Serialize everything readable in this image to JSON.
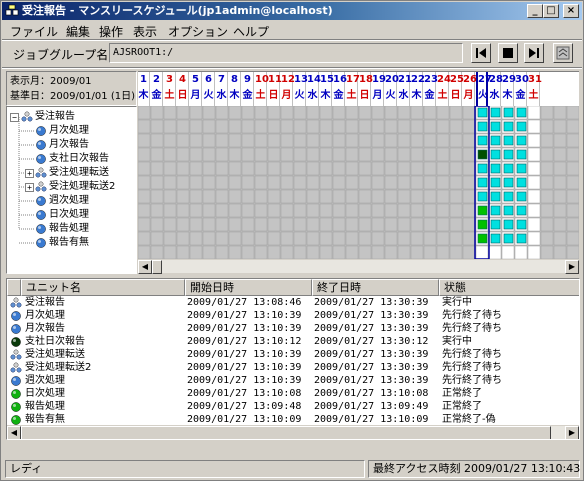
{
  "window": {
    "title": "受注報告 - マンスリースケジュール(jp1admin@localhost)",
    "controls": {
      "minimize": "_",
      "maximize": "□",
      "close": "×"
    }
  },
  "menu": [
    "ファイル",
    "編集",
    "操作",
    "表示",
    "オプション",
    "ヘルプ"
  ],
  "toolbar": {
    "jobgroup_label": "ジョブグループ名:",
    "jobgroup_value": "AJSROOT1:/"
  },
  "info": {
    "display_month": "表示月：2009/01",
    "base_day": "基準日：2009/01/01 (1日)"
  },
  "calendar": {
    "days": [
      {
        "d": "1",
        "w": "木",
        "c": "blue"
      },
      {
        "d": "2",
        "w": "金",
        "c": "blue"
      },
      {
        "d": "3",
        "w": "土",
        "c": "red"
      },
      {
        "d": "4",
        "w": "日",
        "c": "red"
      },
      {
        "d": "5",
        "w": "月",
        "c": "blue"
      },
      {
        "d": "6",
        "w": "火",
        "c": "blue"
      },
      {
        "d": "7",
        "w": "水",
        "c": "blue"
      },
      {
        "d": "8",
        "w": "木",
        "c": "blue"
      },
      {
        "d": "9",
        "w": "金",
        "c": "blue"
      },
      {
        "d": "10",
        "w": "土",
        "c": "red"
      },
      {
        "d": "11",
        "w": "日",
        "c": "red"
      },
      {
        "d": "12",
        "w": "月",
        "c": "red"
      },
      {
        "d": "13",
        "w": "火",
        "c": "blue"
      },
      {
        "d": "14",
        "w": "水",
        "c": "blue"
      },
      {
        "d": "15",
        "w": "木",
        "c": "blue"
      },
      {
        "d": "16",
        "w": "金",
        "c": "blue"
      },
      {
        "d": "17",
        "w": "土",
        "c": "red"
      },
      {
        "d": "18",
        "w": "日",
        "c": "red"
      },
      {
        "d": "19",
        "w": "月",
        "c": "blue"
      },
      {
        "d": "20",
        "w": "火",
        "c": "blue"
      },
      {
        "d": "21",
        "w": "水",
        "c": "blue"
      },
      {
        "d": "22",
        "w": "木",
        "c": "blue"
      },
      {
        "d": "23",
        "w": "金",
        "c": "blue"
      },
      {
        "d": "24",
        "w": "土",
        "c": "red"
      },
      {
        "d": "25",
        "w": "日",
        "c": "red"
      },
      {
        "d": "26",
        "w": "月",
        "c": "red"
      },
      {
        "d": "27",
        "w": "火",
        "c": "blue"
      },
      {
        "d": "28",
        "w": "水",
        "c": "blue"
      },
      {
        "d": "29",
        "w": "木",
        "c": "blue"
      },
      {
        "d": "30",
        "w": "金",
        "c": "blue"
      },
      {
        "d": "31",
        "w": "土",
        "c": "red"
      }
    ]
  },
  "tree": [
    {
      "label": "受注報告",
      "icon": "jobnet-group-icon"
    },
    {
      "label": "月次処理",
      "icon": "job-ball-icon"
    },
    {
      "label": "月次報告",
      "icon": "job-ball-icon"
    },
    {
      "label": "支社日次報告",
      "icon": "job-ball-icon"
    },
    {
      "label": "受注処理転送",
      "icon": "jobnet-group-icon"
    },
    {
      "label": "受注処理転送2",
      "icon": "jobnet-group-icon"
    },
    {
      "label": "週次処理",
      "icon": "job-ball-icon"
    },
    {
      "label": "日次処理",
      "icon": "job-ball-icon"
    },
    {
      "label": "報告処理",
      "icon": "job-ball-icon"
    },
    {
      "label": "報告有無",
      "icon": "job-ball-icon"
    }
  ],
  "schedule": [
    [
      "cyan",
      "cyan",
      "cyan",
      "cyan"
    ],
    [
      "cyan",
      "cyan",
      "cyan",
      "cyan"
    ],
    [
      "cyan",
      "cyan",
      "cyan",
      "cyan"
    ],
    [
      "darkgreen",
      "cyan",
      "cyan",
      "cyan"
    ],
    [
      "cyan",
      "cyan",
      "cyan",
      "cyan"
    ],
    [
      "cyan",
      "cyan",
      "cyan",
      "cyan"
    ],
    [
      "cyan",
      "cyan",
      "cyan",
      "cyan"
    ],
    [
      "green",
      "cyan",
      "cyan",
      "cyan"
    ],
    [
      "green",
      "cyan",
      "cyan",
      "cyan"
    ],
    [
      "green",
      "cyan",
      "cyan",
      "cyan"
    ]
  ],
  "status_colors": {
    "cyan": "#00e0e0",
    "green": "#00c000",
    "darkgreen": "#005000",
    "grid": "#c0c0c0",
    "today": "#0000a0"
  },
  "list": {
    "headers": [
      "ユニット名",
      "開始日時",
      "終了日時",
      "状態"
    ],
    "rows": [
      {
        "name": "受注報告",
        "start": "2009/01/27 13:08:46",
        "end": "2009/01/27 13:30:39",
        "state": "実行中",
        "icon": "jobnet-group-icon"
      },
      {
        "name": "月次処理",
        "start": "2009/01/27 13:10:39",
        "end": "2009/01/27 13:30:39",
        "state": "先行終了待ち",
        "icon": "job-ball-icon"
      },
      {
        "name": "月次報告",
        "start": "2009/01/27 13:10:39",
        "end": "2009/01/27 13:30:39",
        "state": "先行終了待ち",
        "icon": "job-ball-icon"
      },
      {
        "name": "支社日次報告",
        "start": "2009/01/27 13:10:12",
        "end": "2009/01/27 13:30:12",
        "state": "実行中",
        "icon": "job-ball-dark-icon"
      },
      {
        "name": "受注処理転送",
        "start": "2009/01/27 13:10:39",
        "end": "2009/01/27 13:30:39",
        "state": "先行終了待ち",
        "icon": "jobnet-group-icon"
      },
      {
        "name": "受注処理転送2",
        "start": "2009/01/27 13:10:39",
        "end": "2009/01/27 13:30:39",
        "state": "先行終了待ち",
        "icon": "jobnet-group-icon"
      },
      {
        "name": "週次処理",
        "start": "2009/01/27 13:10:39",
        "end": "2009/01/27 13:30:39",
        "state": "先行終了待ち",
        "icon": "job-ball-icon"
      },
      {
        "name": "日次処理",
        "start": "2009/01/27 13:10:08",
        "end": "2009/01/27 13:10:08",
        "state": "正常終了",
        "icon": "job-ball-green-icon"
      },
      {
        "name": "報告処理",
        "start": "2009/01/27 13:09:48",
        "end": "2009/01/27 13:09:49",
        "state": "正常終了",
        "icon": "job-ball-green-icon"
      },
      {
        "name": "報告有無",
        "start": "2009/01/27 13:10:09",
        "end": "2009/01/27 13:10:09",
        "state": "正常終了-偽",
        "icon": "job-ball-green-icon"
      }
    ]
  },
  "statusbar": {
    "left": "レディ",
    "right": "最終アクセス時刻  2009/01/27  13:10:43"
  }
}
